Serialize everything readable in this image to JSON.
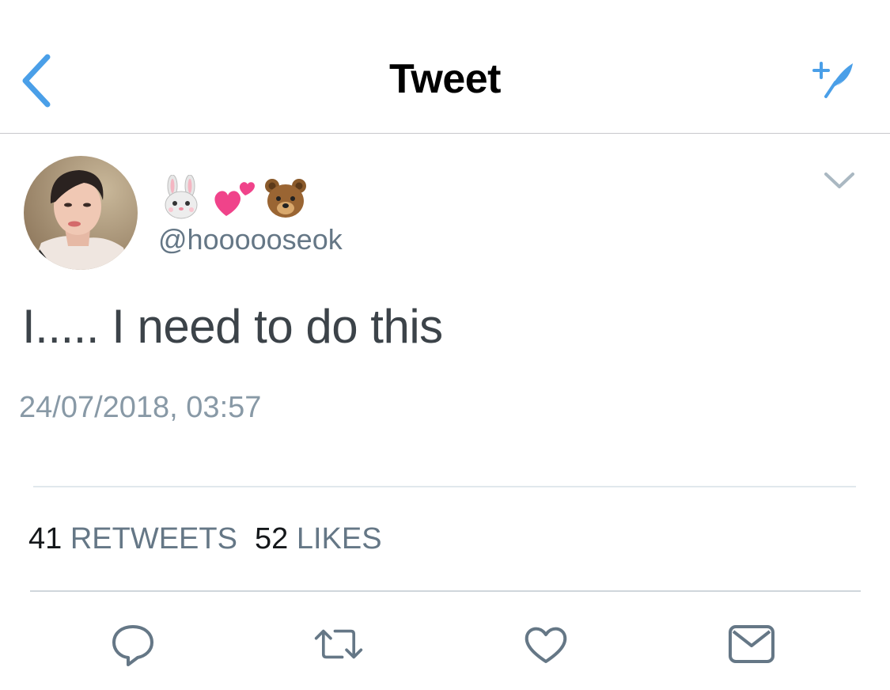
{
  "header": {
    "title": "Tweet",
    "back_icon": "chevron-left-icon",
    "compose_icon": "compose-tweet-icon",
    "accent_color": "#4a9fe8"
  },
  "tweet": {
    "display_name_emojis": [
      "rabbit-face-emoji",
      "two-hearts-emoji",
      "bear-face-emoji"
    ],
    "handle": "@hoooooseok",
    "text": "I..... I need to do this",
    "timestamp": "24/07/2018, 03:57",
    "retweets_count": "41",
    "retweets_label": "RETWEETS",
    "likes_count": "52",
    "likes_label": "LIKES"
  },
  "actions": {
    "reply_icon": "reply-icon",
    "retweet_icon": "retweet-icon",
    "like_icon": "heart-icon",
    "share_icon": "mail-icon"
  },
  "colors": {
    "text_primary": "#14171a",
    "text_secondary": "#657786",
    "icon_gray": "#657786",
    "divider": "#e1e8ed"
  }
}
